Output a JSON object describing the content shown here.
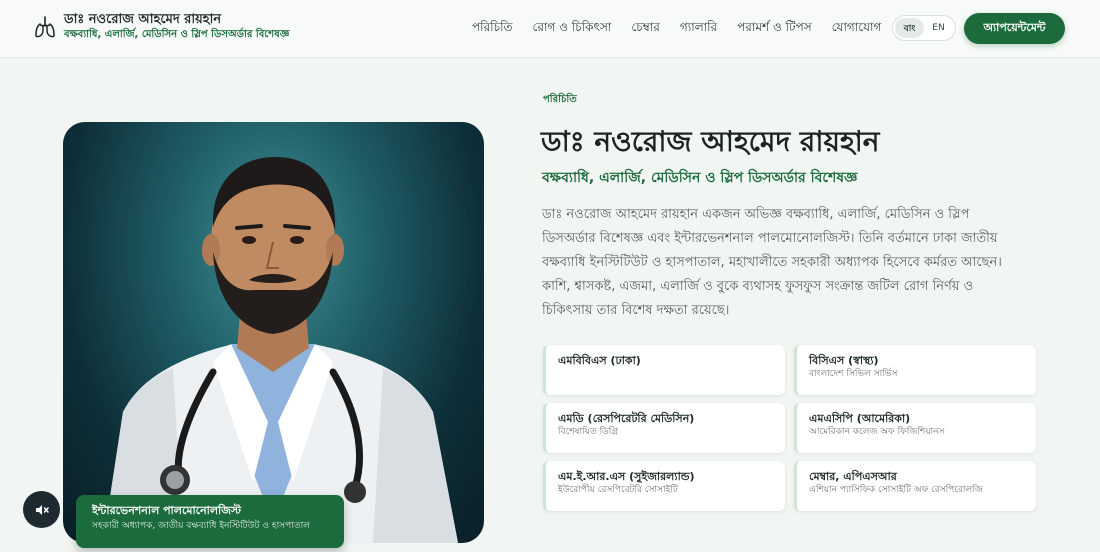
{
  "header": {
    "brand_title": "ডাঃ নওরোজ আহমেদ রায়হান",
    "brand_subtitle": "বক্ষব্যাধি, এলার্জি, মেডিসিন ও স্লিপ ডিসঅর্ডার বিশেষজ্ঞ",
    "brand_icon": "lungs-icon",
    "nav": [
      "পরিচিতি",
      "রোগ ও চিকিৎসা",
      "চেম্বার",
      "গ্যালারি",
      "পরামর্শ ও টিপস",
      "যোগাযোগ"
    ],
    "lang_options": [
      "বাং",
      "EN"
    ],
    "lang_selected": "বাং",
    "cta_label": "অ্যাপয়েন্টমেন্ট"
  },
  "hero": {
    "eyebrow": "পরিচিতি",
    "title": "ডাঃ নওরোজ আহমেদ রায়হান",
    "subtitle": "বক্ষব্যাধি, এলার্জি, মেডিসিন ও স্লিপ ডিসঅর্ডার বিশেষজ্ঞ",
    "bio": "ডাঃ নওরোজ আহমেদ রায়হান একজন অভিজ্ঞ বক্ষব্যাধি, এলার্জি, মেডিসিন ও স্লিপ ডিসঅর্ডার বিশেষজ্ঞ এবং ইন্টারভেনশনাল পালমোনোলজিস্ট। তিনি বর্তমানে ঢাকা জাতীয় বক্ষব্যাধি ইনস্টিটিউট ও হাসপাতাল, মহাখালীতে সহকারী অধ্যাপক হিসেবে কর্মরত আছেন। কাশি, শ্বাসকষ্ট, এজমা, এলার্জি ও বুকে ব্যথাসহ ফুসফুস সংক্রান্ত জটিল রোগ নির্ণয় ও চিকিৎসায় তার বিশেষ দক্ষতা রয়েছে।"
  },
  "badge": {
    "title": "ইন্টারভেনশনাল পালমোনোলজিস্ট",
    "subtitle": "সহকারী অধ্যাপক, জাতীয় বক্ষব্যাধি ইনস্টিটিউট ও হাসপাতাল"
  },
  "mute_icon": "speaker-muted-icon",
  "qualifications": [
    {
      "title": "এমবিবিএস (ঢাকা)",
      "subtitle": ""
    },
    {
      "title": "বিসিএস (স্বাস্থ্য)",
      "subtitle": "বাংলাদেশ সিভিল সার্ভিস"
    },
    {
      "title": "এমডি (রেসপিরেটরি মেডিসিন)",
      "subtitle": "বিশেষায়িত ডিগ্রি"
    },
    {
      "title": "এমএসিপি (আমেরিকা)",
      "subtitle": "আমেরিকান কলেজ অফ ফিজিশিয়ানস"
    },
    {
      "title": "এম.ই.আর.এস (সুইজারল্যান্ড)",
      "subtitle": "ইউরোপীয় রেসপিরেটরি সোসাইটি"
    },
    {
      "title": "মেম্বার, এপিএসআর",
      "subtitle": "এশিয়ান প্যাসিফিক সোসাইটি অফ রেসপিরোলজি"
    }
  ],
  "colors": {
    "primary_green": "#1c6b3c",
    "background": "#f2f6f3",
    "photo_background": "#1f5d66"
  }
}
